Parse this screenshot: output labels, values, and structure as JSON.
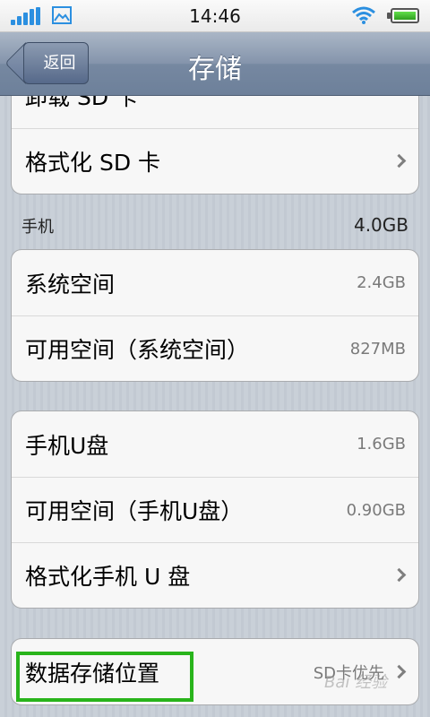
{
  "status_bar": {
    "time": "14:46",
    "icons": [
      "signal-icon",
      "gallery-icon",
      "wifi-icon",
      "battery-icon"
    ],
    "accent": "#2b8fe0"
  },
  "nav": {
    "back_label": "返回",
    "title": "存储"
  },
  "sd_card_group": {
    "partial_row_label": "卸载 SD 卡",
    "format_label": "格式化 SD 卡"
  },
  "phone_section": {
    "header": "手机",
    "total": "4.0GB",
    "rows": [
      {
        "label": "系统空间",
        "value": "2.4GB"
      },
      {
        "label": "可用空间（系统空间）",
        "value": "827MB"
      }
    ]
  },
  "usb_group": {
    "rows": [
      {
        "label": "手机U盘",
        "value": "1.6GB"
      },
      {
        "label": "可用空间（手机U盘）",
        "value": "0.90GB"
      },
      {
        "label": "格式化手机 U 盘",
        "value": ""
      }
    ]
  },
  "storage_location": {
    "label": "数据存储位置",
    "value": "SD卡优先",
    "highlight_color": "#29b41b"
  },
  "watermark": "Bai 经验"
}
